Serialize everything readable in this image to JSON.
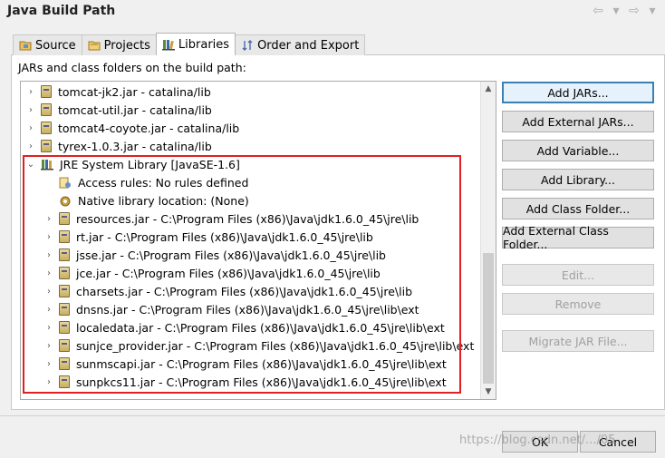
{
  "window": {
    "title": "Java Build Path"
  },
  "nav": {
    "back": "⇦",
    "back_menu": "▾",
    "fwd": "⇨",
    "fwd_menu": "▾"
  },
  "tabs": [
    {
      "label": "Source",
      "icon": "source-folder-icon"
    },
    {
      "label": "Projects",
      "icon": "projects-icon"
    },
    {
      "label": "Libraries",
      "icon": "libraries-icon",
      "active": true
    },
    {
      "label": "Order and Export",
      "icon": "order-export-icon"
    }
  ],
  "panel": {
    "label": "JARs and class folders on the build path:"
  },
  "tree": [
    {
      "text": "tomcat-jk2.jar - catalina/lib",
      "twisty": "›",
      "icon": "jar-icon"
    },
    {
      "text": "tomcat-util.jar - catalina/lib",
      "twisty": "›",
      "icon": "jar-icon"
    },
    {
      "text": "tomcat4-coyote.jar - catalina/lib",
      "twisty": "›",
      "icon": "jar-icon"
    },
    {
      "text": "tyrex-1.0.3.jar - catalina/lib",
      "twisty": "›",
      "icon": "jar-icon"
    },
    {
      "text": "JRE System Library [JavaSE-1.6]",
      "twisty": "⌄",
      "icon": "library-icon"
    },
    {
      "text": "Access rules: No rules defined",
      "twisty": "",
      "icon": "access-rules-icon"
    },
    {
      "text": "Native library location: (None)",
      "twisty": "",
      "icon": "native-library-icon"
    },
    {
      "text": "resources.jar - C:\\Program Files (x86)\\Java\\jdk1.6.0_45\\jre\\lib",
      "twisty": "›",
      "icon": "jar-icon"
    },
    {
      "text": "rt.jar - C:\\Program Files (x86)\\Java\\jdk1.6.0_45\\jre\\lib",
      "twisty": "›",
      "icon": "jar-icon"
    },
    {
      "text": "jsse.jar - C:\\Program Files (x86)\\Java\\jdk1.6.0_45\\jre\\lib",
      "twisty": "›",
      "icon": "jar-icon"
    },
    {
      "text": "jce.jar - C:\\Program Files (x86)\\Java\\jdk1.6.0_45\\jre\\lib",
      "twisty": "›",
      "icon": "jar-icon"
    },
    {
      "text": "charsets.jar - C:\\Program Files (x86)\\Java\\jdk1.6.0_45\\jre\\lib",
      "twisty": "›",
      "icon": "jar-icon"
    },
    {
      "text": "dnsns.jar - C:\\Program Files (x86)\\Java\\jdk1.6.0_45\\jre\\lib\\ext",
      "twisty": "›",
      "icon": "jar-icon"
    },
    {
      "text": "localedata.jar - C:\\Program Files (x86)\\Java\\jdk1.6.0_45\\jre\\lib\\ext",
      "twisty": "›",
      "icon": "jar-icon"
    },
    {
      "text": "sunjce_provider.jar - C:\\Program Files (x86)\\Java\\jdk1.6.0_45\\jre\\lib\\ext",
      "twisty": "›",
      "icon": "jar-icon"
    },
    {
      "text": "sunmscapi.jar - C:\\Program Files (x86)\\Java\\jdk1.6.0_45\\jre\\lib\\ext",
      "twisty": "›",
      "icon": "jar-icon"
    },
    {
      "text": "sunpkcs11.jar - C:\\Program Files (x86)\\Java\\jdk1.6.0_45\\jre\\lib\\ext",
      "twisty": "›",
      "icon": "jar-icon"
    }
  ],
  "scrollbar": {
    "up": "▲",
    "down": "▼"
  },
  "buttons": {
    "add_jars": "Add JARs...",
    "add_external_jars": "Add External JARs...",
    "add_variable": "Add Variable...",
    "add_library": "Add Library...",
    "add_class_folder": "Add Class Folder...",
    "add_external_class_folder": "Add External Class Folder...",
    "edit": "Edit...",
    "remove": "Remove",
    "migrate_jar": "Migrate JAR File..."
  },
  "footer": {
    "ok": "OK",
    "cancel": "Cancel",
    "watermark": "https://blog.csdn.net/.../05"
  },
  "colors": {
    "highlight_box": "#e02020",
    "default_button_border": "#3c7fb1"
  }
}
